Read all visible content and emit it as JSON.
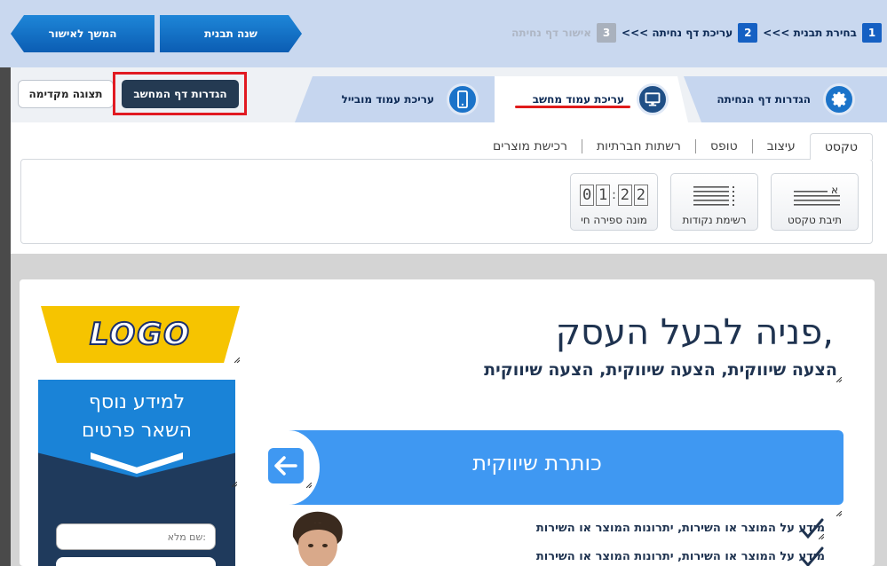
{
  "wizard": {
    "next_label": "המשך לאישור",
    "change_template_label": "שנה תבנית",
    "steps": [
      {
        "num": "1",
        "label": "בחירת תבנית >>>"
      },
      {
        "num": "2",
        "label": "עריכת דף נחיתה >>>"
      },
      {
        "num": "3",
        "label": "אישור דף נחיתה"
      }
    ]
  },
  "tabs": {
    "settings": "הגדרות דף הנחיתה",
    "desktop": "עריכת עמוד מחשב",
    "mobile": "עריכת עמוד מובייל",
    "desktop_settings_button": "הגדרות דף המחשב",
    "preview_button": "תצוגה מקדימה"
  },
  "subtabs": [
    "טקסט",
    "עיצוב",
    "טופס",
    "רשתות חברתיות",
    "רכישת מוצרים"
  ],
  "tools": {
    "text_box": "תיבת טקסט",
    "bullet_list": "רשימת נקודות",
    "counter": "מונה ספירה חי",
    "counter_digits": [
      "0",
      "1",
      "2",
      "2"
    ],
    "text_glyph": "א"
  },
  "canvas": {
    "logo": "LOGO",
    "form_title_line1": "למידע נוסף",
    "form_title_line2": "השאר פרטים",
    "name_placeholder": "שם מלא:",
    "headline": "פניה לבעל העסק,",
    "subheadline": "הצעה שיווקית, הצעה שיווקית, הצעה שיווקית",
    "banner_text": "כותרת  שיווקית",
    "bullets": [
      "מידע על המוצר  או השירות, יתרונות המוצר או השירות",
      "מידע על המוצר  או השירות, יתרונות המוצר או השירות"
    ]
  },
  "colors": {
    "accent_blue": "#1560c3",
    "highlight_red": "#e11a22",
    "logo_yellow": "#f6c400",
    "banner_blue": "#3f98f2",
    "navy": "#1f3350"
  }
}
